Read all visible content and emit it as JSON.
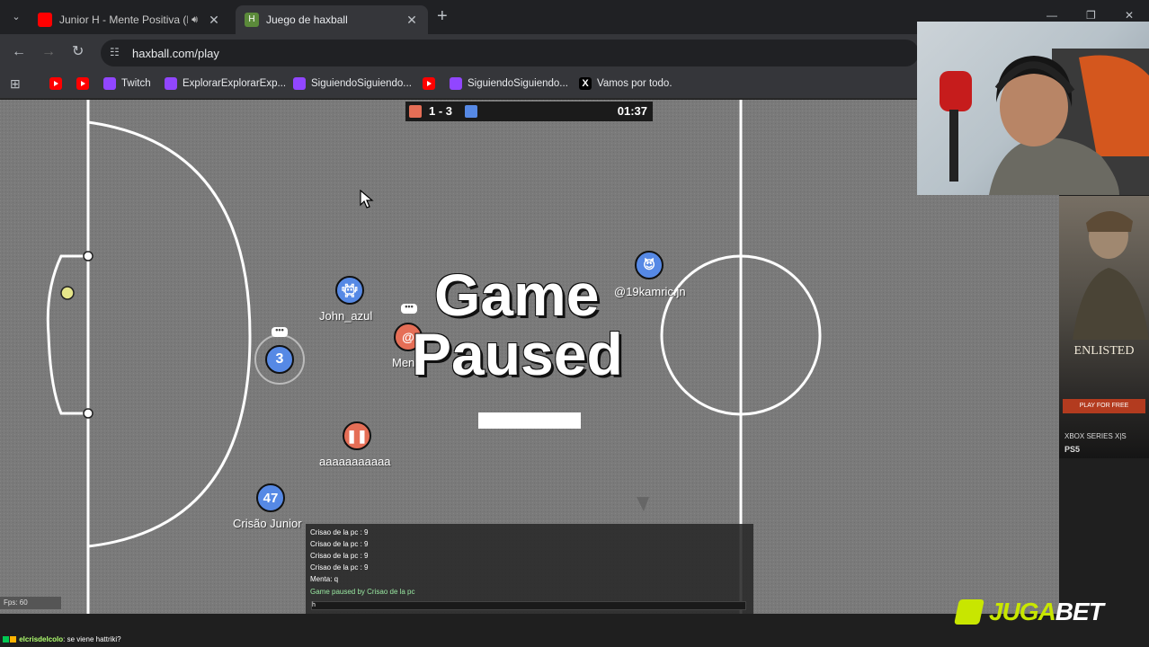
{
  "browser": {
    "tabs": [
      {
        "title": "Junior H - Mente Positiva (L",
        "active": false
      },
      {
        "title": "Juego de haxball",
        "active": true
      }
    ],
    "url": "haxball.com/play",
    "bookmarks": [
      {
        "label": "",
        "icon": "youtube-icon"
      },
      {
        "label": "",
        "icon": "youtube-icon"
      },
      {
        "label": "Twitch",
        "icon": "twitch-icon"
      },
      {
        "label": "ExplorarExplorarExp...",
        "icon": "twitch-icon"
      },
      {
        "label": "SiguiendoSiguiendo...",
        "icon": "twitch-icon"
      },
      {
        "label": "",
        "icon": "youtube-icon"
      },
      {
        "label": "SiguiendoSiguiendo...",
        "icon": "twitch-icon"
      },
      {
        "label": "Vamos por todo.",
        "icon": "x-icon"
      }
    ]
  },
  "game": {
    "score": "1 - 3",
    "clock": "01:37",
    "red_color": "#e56e56",
    "blue_color": "#5689e5",
    "paused_title_line1": "Game",
    "paused_title_line2": "Paused",
    "players": [
      {
        "name": "John_azul",
        "avatar": "avatar-icon",
        "team": "blue"
      },
      {
        "name": "@19kamric.jn",
        "avatar": "devil-icon",
        "team": "blue"
      },
      {
        "name": "Men",
        "avatar": "@",
        "team": "red"
      },
      {
        "name": "",
        "avatar": "3",
        "team": "blue"
      },
      {
        "name": "aaaaaaaaaaa",
        "avatar": "pause-icon",
        "team": "red"
      },
      {
        "name": "Crisão Junior",
        "avatar": "47",
        "team": "blue"
      }
    ],
    "bubble_text": "•••",
    "fps": "Fps: 60",
    "chat": [
      "Crisao de la pc : 9",
      "Crisao de la pc : 9",
      "Crisao de la pc : 9",
      "Crisao de la pc : 9",
      "Menta: q",
      "Game paused by Crisao de la pc"
    ],
    "chat_input": "h",
    "system_message_color": "#98e6a0"
  },
  "overlay": {
    "ad_title": "ENLISTED",
    "ad_button": "PLAY FOR FREE",
    "ad_platform1": "XBOX SERIES X|S",
    "ad_platform2": "PS5",
    "sponsor_a": "JUGA",
    "sponsor_b": "BET",
    "stream_chat_user": "elcrisdelcolo",
    "stream_chat_message": ": se viene hattriki?"
  }
}
